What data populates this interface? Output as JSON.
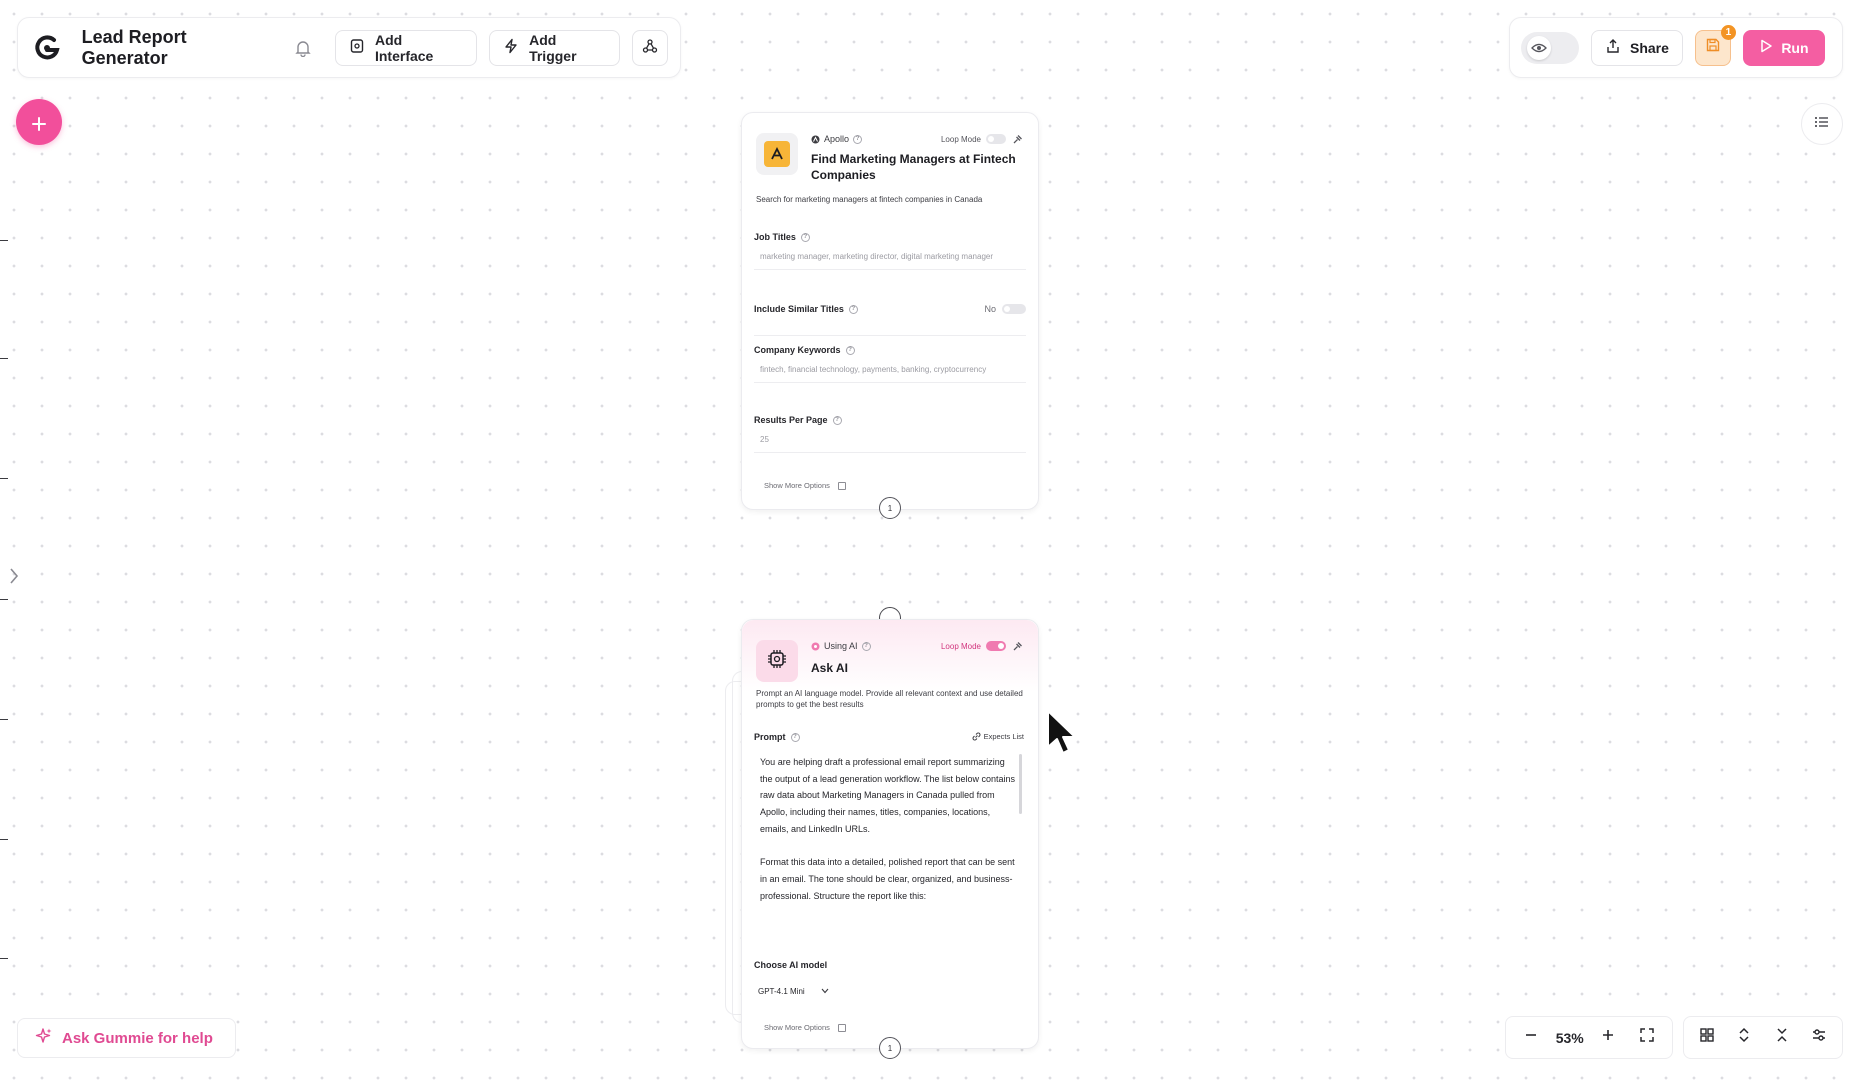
{
  "header": {
    "app_title": "Lead Report Generator",
    "add_interface_label": "Add Interface",
    "add_trigger_label": "Add Trigger"
  },
  "topbar": {
    "share_label": "Share",
    "run_label": "Run",
    "save_badge_count": "1"
  },
  "colors": {
    "accent_pink": "#f24f9b",
    "run_button": "#f45ea2",
    "save_orange": "#f39424"
  },
  "node_apollo": {
    "provider": "Apollo",
    "loop_mode_label": "Loop Mode",
    "title": "Find Marketing Managers at Fintech Companies",
    "description": "Search for marketing managers at fintech companies in Canada",
    "fields": {
      "job_titles_label": "Job Titles",
      "job_titles_value": "marketing manager, marketing director, digital marketing manager",
      "include_similar_label": "Include Similar Titles",
      "include_similar_value": "No",
      "company_keywords_label": "Company Keywords",
      "company_keywords_value": "fintech, financial technology, payments, banking, cryptocurrency",
      "results_per_page_label": "Results Per Page",
      "results_per_page_value": "25"
    },
    "show_more_label": "Show More Options",
    "output_port_label": "1"
  },
  "node_ai": {
    "provider": "Using AI",
    "loop_mode_label": "Loop Mode",
    "title": "Ask AI",
    "description": "Prompt an AI language model. Provide all relevant context and use detailed prompts to get the best results",
    "prompt_label": "Prompt",
    "expects_list_label": "Expects List",
    "prompt_text": "You are helping draft a professional email report summarizing the output of a lead generation workflow. The list below contains raw data about Marketing Managers in Canada pulled from Apollo, including their names, titles, companies, locations, emails, and LinkedIn URLs.\n\nFormat this data into a detailed, polished report that can be sent in an email. The tone should be clear, organized, and business-professional. Structure the report like this:",
    "model_label": "Choose AI model",
    "model_value": "GPT-4.1 Mini",
    "show_more_label": "Show More Options",
    "output_port_label": "1"
  },
  "help": {
    "ask_label": "Ask Gummie for help"
  },
  "zoom": {
    "level": "53%"
  },
  "icons": [
    "gumloop-logo",
    "bell-icon",
    "interface-icon",
    "trigger-bolt-icon",
    "webhook-icon",
    "eye-icon",
    "share-icon",
    "save-icon",
    "play-icon",
    "plus-icon",
    "list-icon",
    "chevron-right-icon",
    "sparkle-icon",
    "minus-icon",
    "fullscreen-icon",
    "grid-icon",
    "expand-icon",
    "collapse-icon",
    "settings-sliders-icon"
  ]
}
